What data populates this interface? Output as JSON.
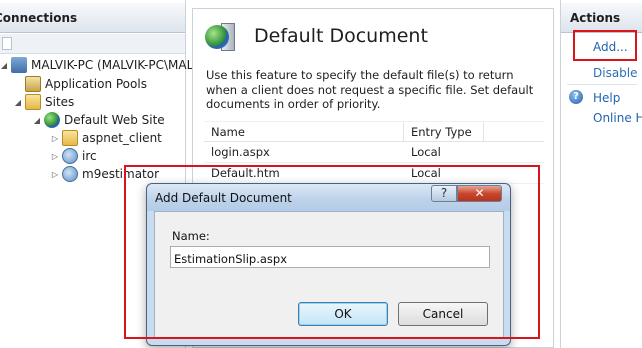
{
  "connections": {
    "header": "Connections",
    "tree": [
      {
        "label": "MALVIK-PC (MALVIK-PC\\MALVIK)",
        "expander": "◢",
        "icon": "pc-icon"
      },
      {
        "label": "Application Pools",
        "expander": "",
        "icon": "app-pool-icon"
      },
      {
        "label": "Sites",
        "expander": "◢",
        "icon": "sites-folder-icon"
      },
      {
        "label": "Default Web Site",
        "expander": "◢",
        "icon": "globe-icon"
      },
      {
        "label": "aspnet_client",
        "expander": "▷",
        "icon": "folder-icon"
      },
      {
        "label": "irc",
        "expander": "▷",
        "icon": "application-icon"
      },
      {
        "label": "m9estimator",
        "expander": "▷",
        "icon": "application-icon"
      }
    ]
  },
  "feature": {
    "title": "Default Document",
    "description": "Use this feature to specify the default file(s) to return when a client does not request a specific file. Set default documents in order of priority.",
    "columns": [
      "Name",
      "Entry Type"
    ],
    "rows": [
      {
        "name": "login.aspx",
        "type": "Local"
      },
      {
        "name": "Default.htm",
        "type": "Local"
      }
    ]
  },
  "actions": {
    "header": "Actions",
    "add": "Add...",
    "disable": "Disable",
    "help": "Help",
    "online_help": "Online Help"
  },
  "dialog": {
    "title": "Add Default Document",
    "help_glyph": "?",
    "close_glyph": "✕",
    "name_label": "Name:",
    "name_value": "EstimationSlip.aspx",
    "ok": "OK",
    "cancel": "Cancel"
  },
  "colors": {
    "highlight_box": "#d7151b",
    "link": "#1f64b0",
    "dialog_frame": "#c9dbef"
  }
}
